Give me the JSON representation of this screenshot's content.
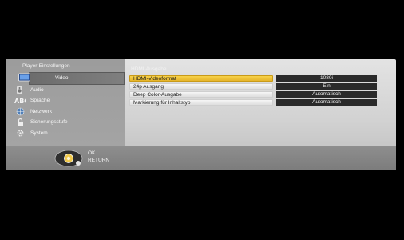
{
  "sidebar": {
    "title": "Player-Einstellungen",
    "items": [
      {
        "label": "Video",
        "icon": "video-icon"
      },
      {
        "label": "Audio",
        "icon": "audio-icon"
      },
      {
        "label": "Sprache",
        "icon": "language-icon"
      },
      {
        "label": "Netzwerk",
        "icon": "network-icon"
      },
      {
        "label": "Sicherungsstufe",
        "icon": "lock-icon"
      },
      {
        "label": "System",
        "icon": "system-icon"
      }
    ],
    "active": "Video"
  },
  "main": {
    "header": "HDMI-Ausgabe",
    "settings": [
      {
        "label": "HDMI-Videoformat",
        "value": "1080i"
      },
      {
        "label": "24p Ausgang",
        "value": "Ein"
      },
      {
        "label": "Deep Color-Ausgabe",
        "value": "Automatisch"
      },
      {
        "label": "Markierung für Inhaltstyp",
        "value": "Automatisch"
      }
    ]
  },
  "footer": {
    "ok_label": "OK",
    "return_label": "RETURN"
  },
  "colors": {
    "selected_row": "#f2c73a",
    "value_box": "#2a2a2a",
    "panel": "#d8d8d8"
  }
}
